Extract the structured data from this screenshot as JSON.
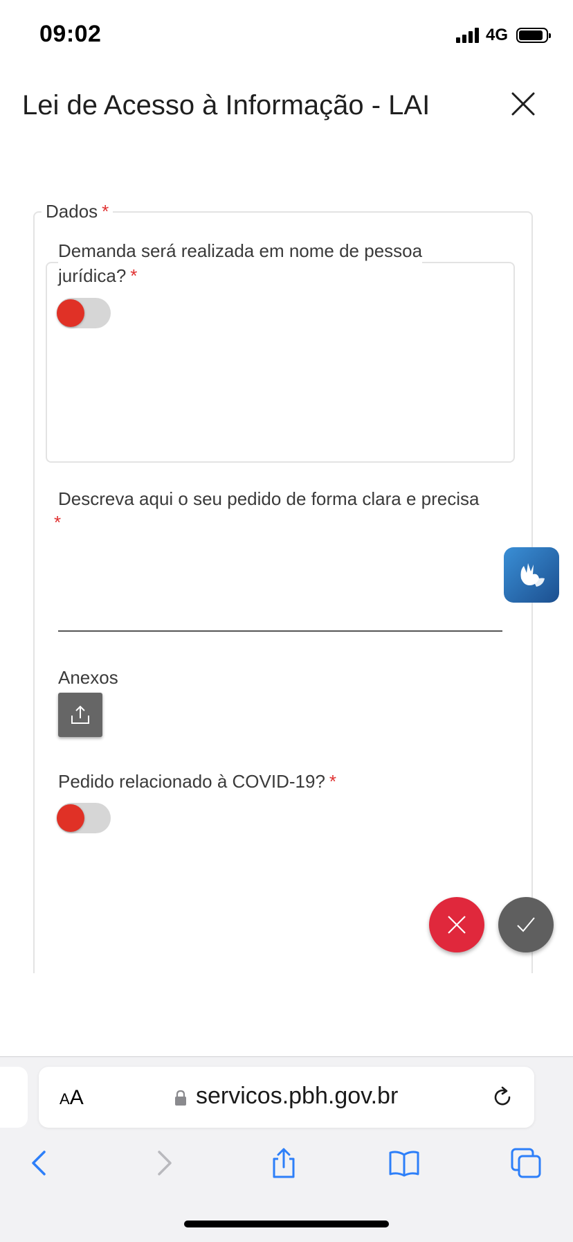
{
  "status_bar": {
    "time": "09:02",
    "network": "4G"
  },
  "header": {
    "title": "Lei de Acesso à Informação - LAI"
  },
  "form": {
    "section_legend": "Dados",
    "required_mark": "*",
    "q1_line1": "Demanda será realizada em nome de pessoa",
    "q1_line2": "jurídica?",
    "q1_value": false,
    "description_label": "Descreva aqui o seu pedido de forma clara e precisa",
    "attachments_label": "Anexos",
    "covid_label": "Pedido relacionado à COVID-19?",
    "covid_value": false
  },
  "browser": {
    "text_size_label_big": "A",
    "text_size_label_small": "A",
    "url": "servicos.pbh.gov.br"
  },
  "colors": {
    "accent_red": "#e03126",
    "cancel_red": "#e0283c",
    "confirm_gray": "#5f5f5f",
    "ios_blue": "#2d7ff9"
  }
}
